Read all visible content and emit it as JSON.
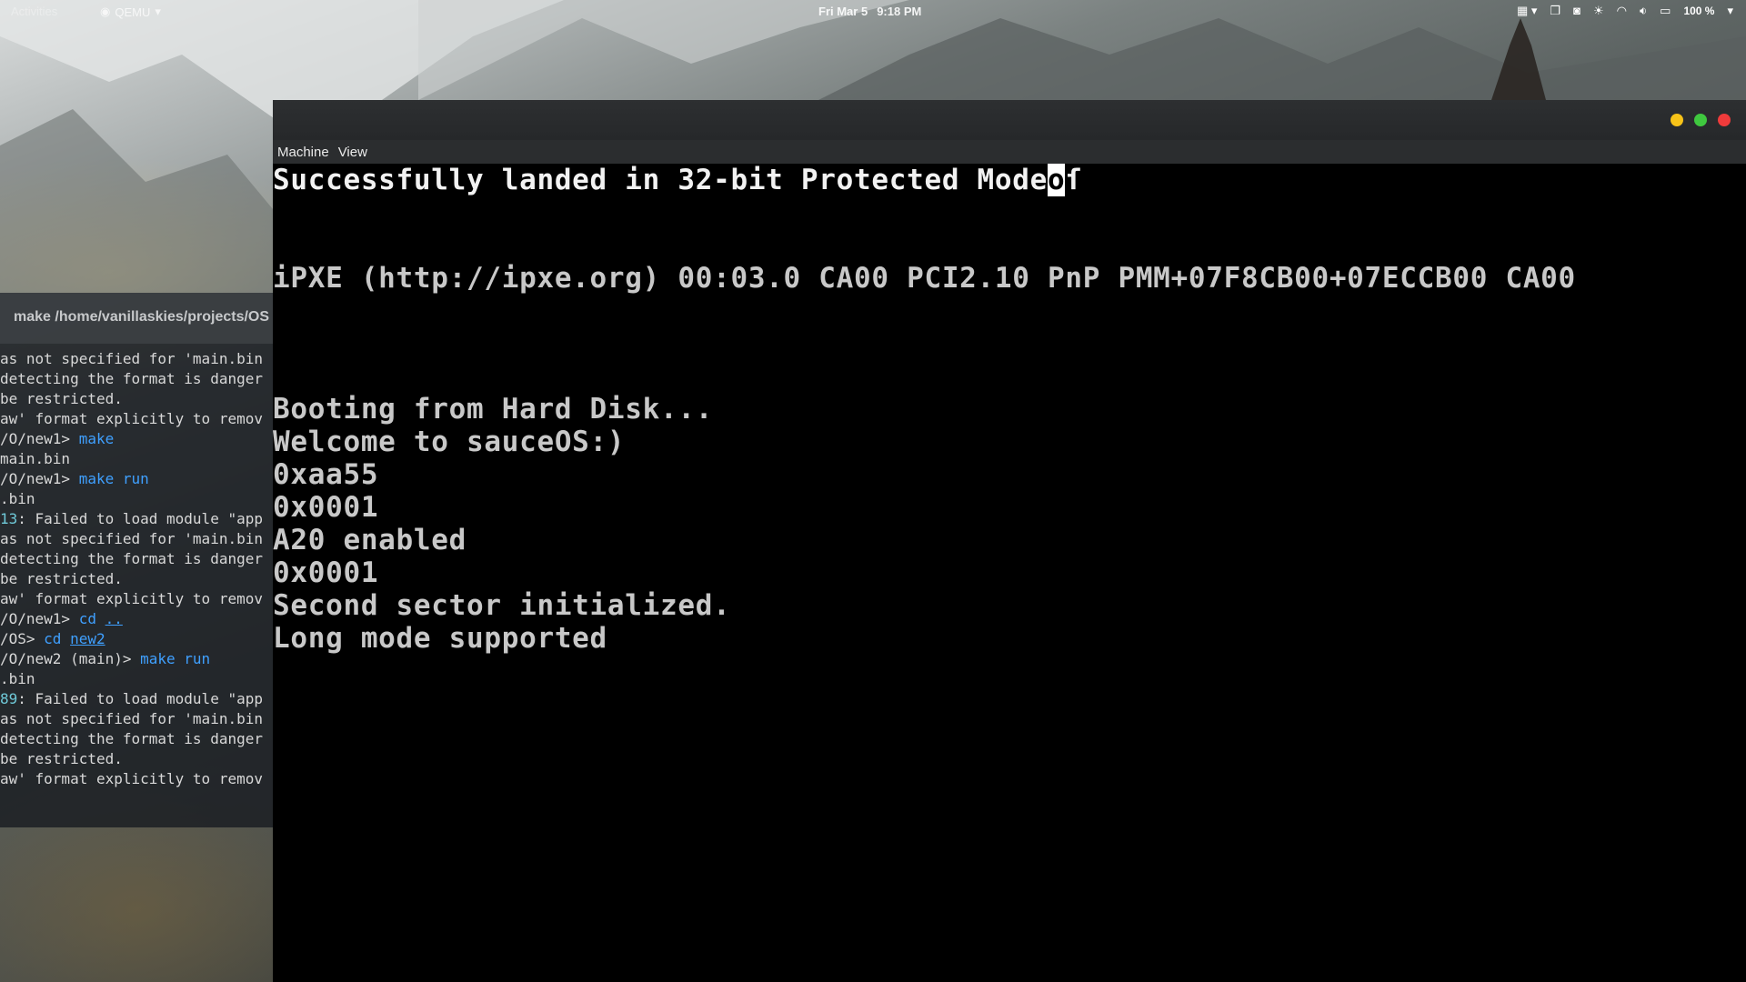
{
  "topbar": {
    "activities": "Activities",
    "app_name": "QEMU",
    "date": "Fri Mar 5",
    "time": "9:18 PM",
    "battery": "100 %"
  },
  "terminal": {
    "title": "make /home/vanillaskies/projects/OS",
    "lines": [
      [
        {
          "t": "as not specified for 'main.bin"
        }
      ],
      [
        {
          "t": "detecting the format is danger"
        }
      ],
      [
        {
          "t": "be restricted."
        }
      ],
      [
        {
          "t": "aw' format explicitly to remov"
        }
      ],
      [
        {
          "t": "/O/new1> "
        },
        {
          "t": "make",
          "c": "cmd"
        }
      ],
      [
        {
          "t": "main.bin"
        }
      ],
      [
        {
          "t": "/O/new1> "
        },
        {
          "t": "make run",
          "c": "cmd"
        }
      ],
      [
        {
          "t": ".bin"
        }
      ],
      [
        {
          "t": "13",
          "c": "num"
        },
        {
          "t": ": Failed to load module \"app"
        }
      ],
      [
        {
          "t": "as not specified for 'main.bin"
        }
      ],
      [
        {
          "t": "detecting the format is danger"
        }
      ],
      [
        {
          "t": "be restricted."
        }
      ],
      [
        {
          "t": "aw' format explicitly to remov"
        }
      ],
      [
        {
          "t": "/O/new1> "
        },
        {
          "t": "cd ",
          "c": "cmd"
        },
        {
          "t": "..",
          "c": "path"
        }
      ],
      [
        {
          "t": "/OS> "
        },
        {
          "t": "cd ",
          "c": "cmd"
        },
        {
          "t": "new2",
          "c": "path"
        }
      ],
      [
        {
          "t": "/O/new2 (main)> "
        },
        {
          "t": "make run",
          "c": "cmd"
        }
      ],
      [
        {
          "t": ".bin"
        }
      ],
      [
        {
          "t": "89",
          "c": "num"
        },
        {
          "t": ": Failed to load module \"app"
        }
      ],
      [
        {
          "t": "as not specified for 'main.bin"
        }
      ],
      [
        {
          "t": "detecting the format is danger"
        }
      ],
      [
        {
          "t": "be restricted."
        }
      ],
      [
        {
          "t": "aw' format explicitly to remov"
        }
      ]
    ]
  },
  "qemu": {
    "menu": [
      "Machine",
      "View"
    ],
    "screen": {
      "line1_before": "Successfully landed in 32-bit Protected Mode",
      "line1_cursor": "o",
      "line1_after": "ſ",
      "lines": [
        "iPXE (http://ipxe.org) 00:03.0 CA00 PCI2.10 PnP PMM+07F8CB00+07ECCB00 CA00",
        "Booting from Hard Disk...",
        "Welcome to sauceOS:)",
        "0xaa55",
        "0x0001",
        "A20 enabled",
        "0x0001",
        "Second sector initialized.",
        "Long mode supported"
      ]
    }
  }
}
